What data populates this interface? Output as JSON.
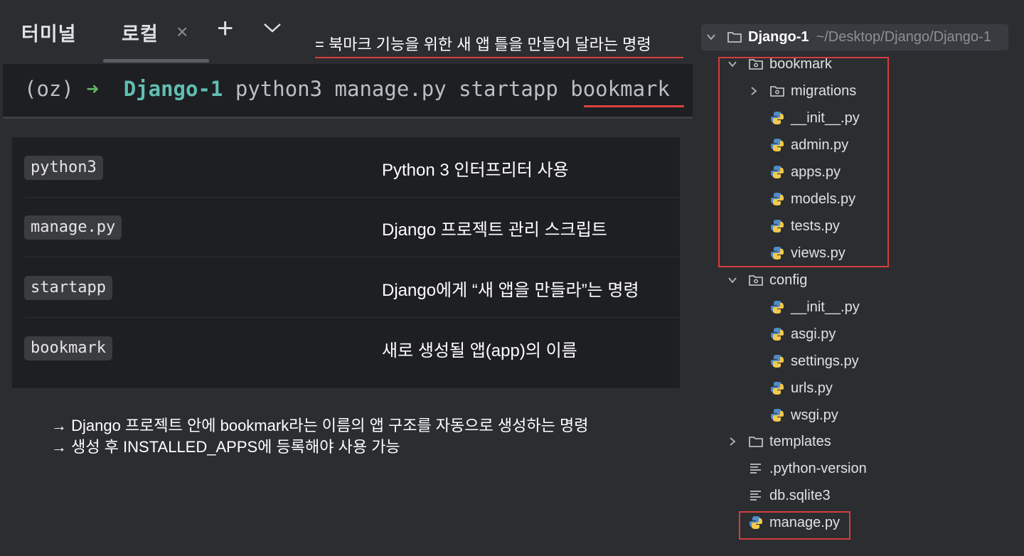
{
  "terminal": {
    "title": "터미널",
    "tab_label": "로컬",
    "annotation": "= 북마크 기능을 위한 새 앱 틀을 만들어 달라는 명령",
    "command": {
      "env": "(oz)",
      "arrow": "➜",
      "dir": "Django-1",
      "text": "python3 manage.py startapp bookmark"
    }
  },
  "explanations": [
    {
      "code": "python3",
      "desc": "Python 3 인터프리터 사용"
    },
    {
      "code": "manage.py",
      "desc": "Django 프로젝트 관리 스크립트"
    },
    {
      "code": "startapp",
      "desc": "Django에게 “새 앱을 만들라”는 명령"
    },
    {
      "code": "bookmark",
      "desc": "새로 생성될 앱(app)의 이름"
    }
  ],
  "notes": [
    "→ Django 프로젝트 안에 bookmark라는 이름의 앱 구조를 자동으로 생성하는 명령",
    "→ 생성 후 INSTALLED_APPS에 등록해야 사용 가능"
  ],
  "project_tree": {
    "root_name": "Django-1",
    "root_path": "~/Desktop/Django/Django-1",
    "items": [
      {
        "label": "bookmark",
        "kind": "package",
        "expanded": true
      },
      {
        "label": "migrations",
        "kind": "package",
        "expanded": false
      },
      {
        "label": "__init__.py",
        "kind": "python"
      },
      {
        "label": "admin.py",
        "kind": "python"
      },
      {
        "label": "apps.py",
        "kind": "python"
      },
      {
        "label": "models.py",
        "kind": "python"
      },
      {
        "label": "tests.py",
        "kind": "python"
      },
      {
        "label": "views.py",
        "kind": "python"
      },
      {
        "label": "config",
        "kind": "package",
        "expanded": true
      },
      {
        "label": "__init__.py",
        "kind": "python"
      },
      {
        "label": "asgi.py",
        "kind": "python"
      },
      {
        "label": "settings.py",
        "kind": "python"
      },
      {
        "label": "urls.py",
        "kind": "python"
      },
      {
        "label": "wsgi.py",
        "kind": "python"
      },
      {
        "label": "templates",
        "kind": "folder",
        "expanded": false
      },
      {
        "label": ".python-version",
        "kind": "text"
      },
      {
        "label": "db.sqlite3",
        "kind": "text"
      },
      {
        "label": "manage.py",
        "kind": "python"
      }
    ]
  },
  "colors": {
    "background": "#2b2d30",
    "terminal_bg": "#1e1f22",
    "highlight_red": "#d43d3d",
    "prompt_green": "#5fb865",
    "dir_teal": "#5fbfb2"
  }
}
